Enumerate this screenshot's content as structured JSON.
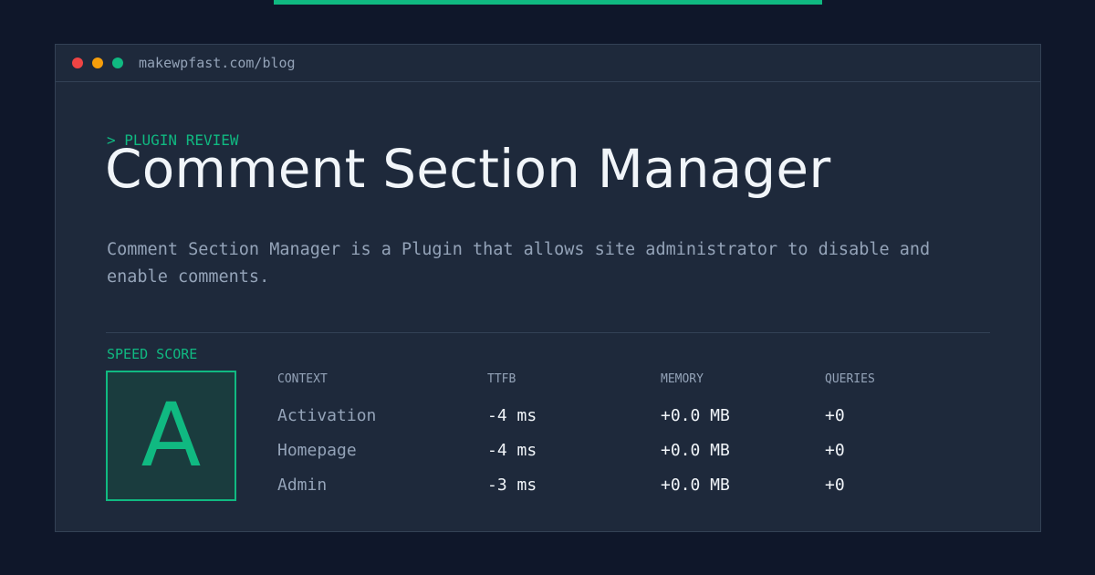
{
  "window": {
    "url": "makewpfast.com/blog"
  },
  "header": {
    "eyebrow": "> PLUGIN REVIEW",
    "title": "Comment Section Manager",
    "description": "Comment Section Manager is a Plugin that allows site administrator to disable and enable comments."
  },
  "score": {
    "label": "SPEED SCORE",
    "grade": "A"
  },
  "table": {
    "headers": [
      "CONTEXT",
      "TTFB",
      "MEMORY",
      "QUERIES"
    ],
    "rows": [
      [
        "Activation",
        "-4 ms",
        "+0.0 MB",
        "+0"
      ],
      [
        "Homepage",
        "-4 ms",
        "+0.0 MB",
        "+0"
      ],
      [
        "Admin",
        "-3 ms",
        "+0.0 MB",
        "+0"
      ]
    ]
  },
  "colors": {
    "accent": "#10b981",
    "background": "#0f172a",
    "panel": "#1e293b",
    "border": "#334155",
    "muted_text": "#94a3b8",
    "bright_text": "#f1f5f9",
    "dot_red": "#ef4444",
    "dot_yellow": "#f59e0b",
    "dot_green": "#10b981"
  }
}
